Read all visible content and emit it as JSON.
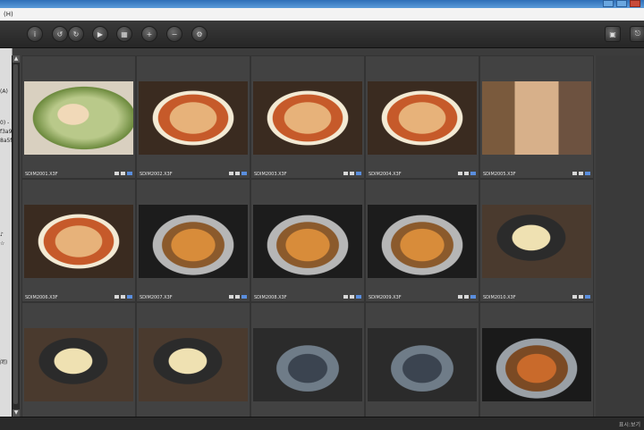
{
  "menubar": {
    "label": "(H)"
  },
  "left_panel": {
    "labels": [
      "(A)",
      "0) -",
      "f3a9",
      "8a5f",
      "♪",
      "☆",
      "闭)"
    ]
  },
  "status": {
    "text": "표시:보기"
  },
  "grid": {
    "items": [
      {
        "filename": "SDIM2001.X3F",
        "photo": "pasta"
      },
      {
        "filename": "SDIM2002.X3F",
        "photo": "pizza"
      },
      {
        "filename": "SDIM2003.X3F",
        "photo": "pizza"
      },
      {
        "filename": "SDIM2004.X3F",
        "photo": "pizza"
      },
      {
        "filename": "SDIM2005.X3F",
        "photo": "woman"
      },
      {
        "filename": "SDIM2006.X3F",
        "photo": "pizza"
      },
      {
        "filename": "SDIM2007.X3F",
        "photo": "grill"
      },
      {
        "filename": "SDIM2008.X3F",
        "photo": "grill"
      },
      {
        "filename": "SDIM2009.X3F",
        "photo": "grill"
      },
      {
        "filename": "SDIM2010.X3F",
        "photo": "cafe"
      },
      {
        "filename": "",
        "photo": "cafe"
      },
      {
        "filename": "",
        "photo": "cafe"
      },
      {
        "filename": "",
        "photo": "mussel"
      },
      {
        "filename": "",
        "photo": "mussel"
      },
      {
        "filename": "",
        "photo": "meat"
      }
    ]
  },
  "toolbar": {
    "left_icons": [
      "info-icon",
      "rotate-left-icon",
      "rotate-right-icon",
      "slideshow-icon",
      "print-icon",
      "zoom-in-icon",
      "zoom-out-icon",
      "settings-icon"
    ],
    "right_icons": [
      "save-icon",
      "exit-icon"
    ]
  }
}
